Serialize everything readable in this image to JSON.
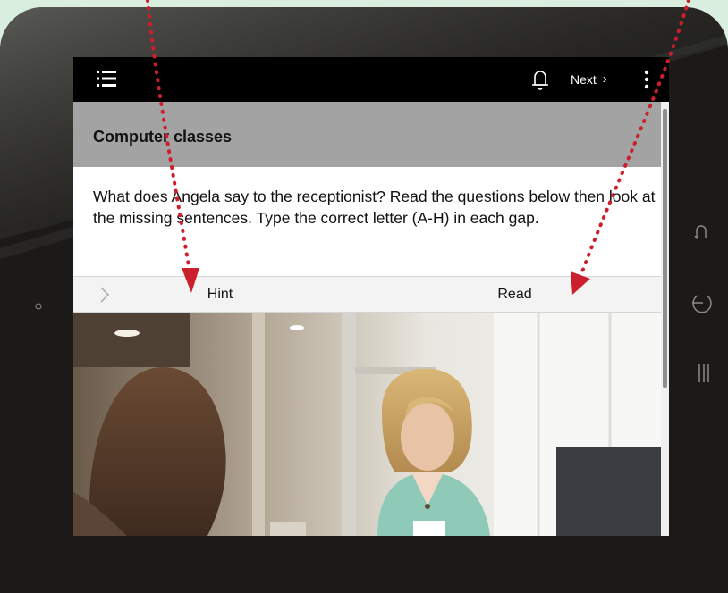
{
  "topbar": {
    "menu_icon": "list-menu-icon",
    "bell_icon": "bell-icon",
    "next_label": "Next",
    "next_chevron": "›",
    "more_icon": "more-vertical-icon"
  },
  "lesson": {
    "title": "Computer classes",
    "instructions": "What does Angela say to the receptionist? Read the questions below then look at the missing sentences. Type the correct letter (A-H) in each gap."
  },
  "tabs": [
    {
      "label": "Hint",
      "icon": "chevron-right-icon"
    },
    {
      "label": "Read"
    }
  ],
  "image": {
    "description_icon": "photo-receptionist"
  },
  "device": {
    "side_buttons": [
      "curved-arrow-icon",
      "power-icon",
      "pause-bars-icon"
    ],
    "camera_icon": "camera-dot-icon"
  },
  "colors": {
    "page_background": "#d9eedf",
    "tablet_body": "#1b1a18",
    "title_bar": "#a3a3a3",
    "arrow_red": "#cc1f2d"
  }
}
